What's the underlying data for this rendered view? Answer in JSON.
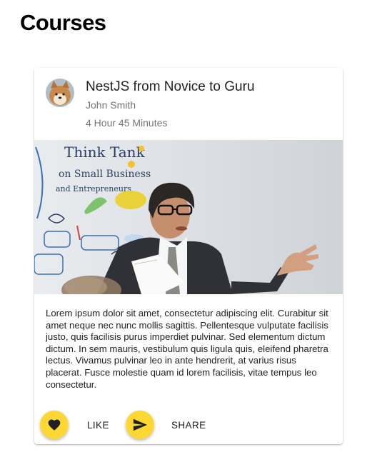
{
  "page": {
    "title": "Courses"
  },
  "course": {
    "title": "NestJS from Novice to Guru",
    "author": "John Smith",
    "duration": "4 Hour 45 Minutes",
    "description": "Lorem ipsum dolor sit amet, consectetur adipiscing elit. Curabitur sit amet neque nec nunc mollis sagittis. Pellentesque vulputate facilisis justo, quis facilisis purus imperdiet pulvinar. Sed elementum dictum dictum. In sem mauris, vestibulum quis ligula quis, eleifend pharetra lectus. Vivamus pulvinar leo in ante hendrerit, at varius risus placerat. Fusce molestie quam id lorem facilisis, vitae tempus leo consectetur."
  },
  "media": {
    "whiteboard_line1": "Think Tank",
    "whiteboard_line2": "on Small Business",
    "whiteboard_line3": "and Entrepreneurs"
  },
  "actions": {
    "like_label": "LIKE",
    "share_label": "SHARE",
    "like_icon": "heart-icon",
    "share_icon": "send-icon"
  },
  "colors": {
    "fab": "#fdd835",
    "icon": "#212121",
    "secondary_text": "#757575"
  }
}
